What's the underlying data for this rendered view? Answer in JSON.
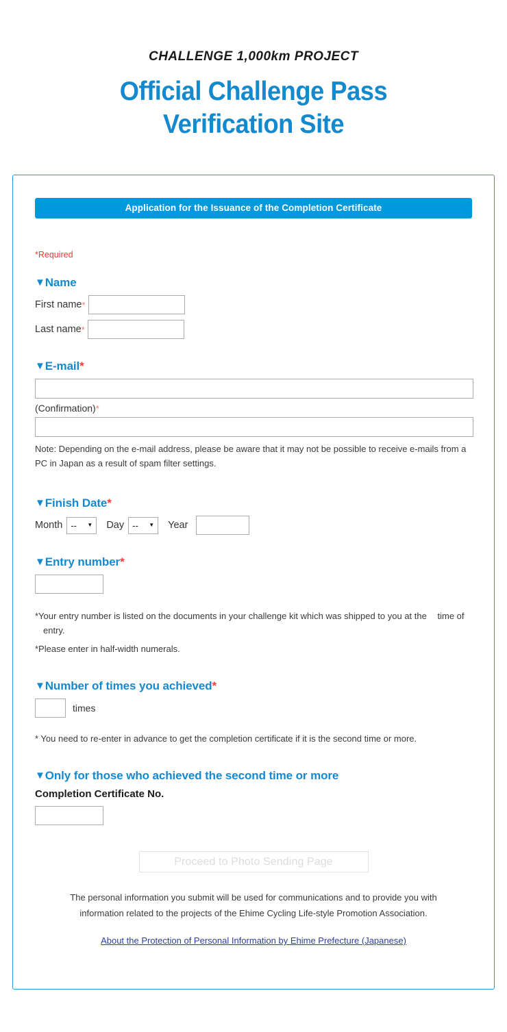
{
  "header": {
    "kicker": "CHALLENGE 1,000km PROJECT",
    "title_line1": "Official Challenge Pass",
    "title_line2": "Verification Site"
  },
  "colors": {
    "brand_blue": "#0099dd",
    "title_blue": "#1589ce",
    "required_red": "#ff3333",
    "link_blue": "#2b3f9e",
    "border_grey": "#aaaaaa"
  },
  "banner": {
    "label": "Application for the Issuance of the Completion Certificate"
  },
  "required_note": "*Required",
  "form": {
    "name": {
      "heading": "Name",
      "caret": "▼",
      "asterisk": "*",
      "first_name_label": "First name",
      "first_name_value": "",
      "first_name_required": "*",
      "last_name_label": "Last name",
      "last_name_value": "",
      "last_name_required": "*"
    },
    "email": {
      "heading": "E-mail",
      "caret": "▼",
      "asterisk": "*",
      "email_value": "",
      "confirmation_label": "(Confirmation)",
      "confirmation_required": "*",
      "confirmation_value": "",
      "note": "Note: Depending on the e-mail address, please be aware that it may not be possible to receive e-mails from a PC in Japan as a result of spam filter settings."
    },
    "finish_date": {
      "heading": "Finish Date",
      "caret": "▼",
      "asterisk": "*",
      "month_label": "Month",
      "month_selected": "--",
      "day_label": "Day",
      "day_selected": "--",
      "year_label": "Year",
      "year_value": ""
    },
    "entry_number": {
      "heading": "Entry number",
      "caret": "▼",
      "asterisk": "*",
      "value": "",
      "note1": "*Your entry number is listed on the documents in your challenge kit which was shipped to you at the",
      "note1_cont": "time of entry.",
      "note2": "*Please enter in half-width numerals."
    },
    "times_achieved": {
      "heading": "Number of times you achieved",
      "caret": "▼",
      "asterisk": "*",
      "value": "",
      "unit": "times",
      "note": "* You need to re-enter in advance to get the completion certificate if it is the second time or more."
    },
    "second_time": {
      "heading": "Only for those who achieved the second time or more",
      "caret": "▼",
      "cert_no_label": "Completion Certificate No.",
      "cert_no_value": ""
    }
  },
  "submit": {
    "label": "Proceed to Photo Sending Page",
    "disabled": true
  },
  "footer": {
    "privacy_note_line1": "The personal information you submit will be used for communications and to provide you with",
    "privacy_note_line2": "information related to the projects of the Ehime Cycling Life-style Promotion Association.",
    "privacy_link": "About the Protection of Personal Information by Ehime Prefecture (Japanese)"
  }
}
